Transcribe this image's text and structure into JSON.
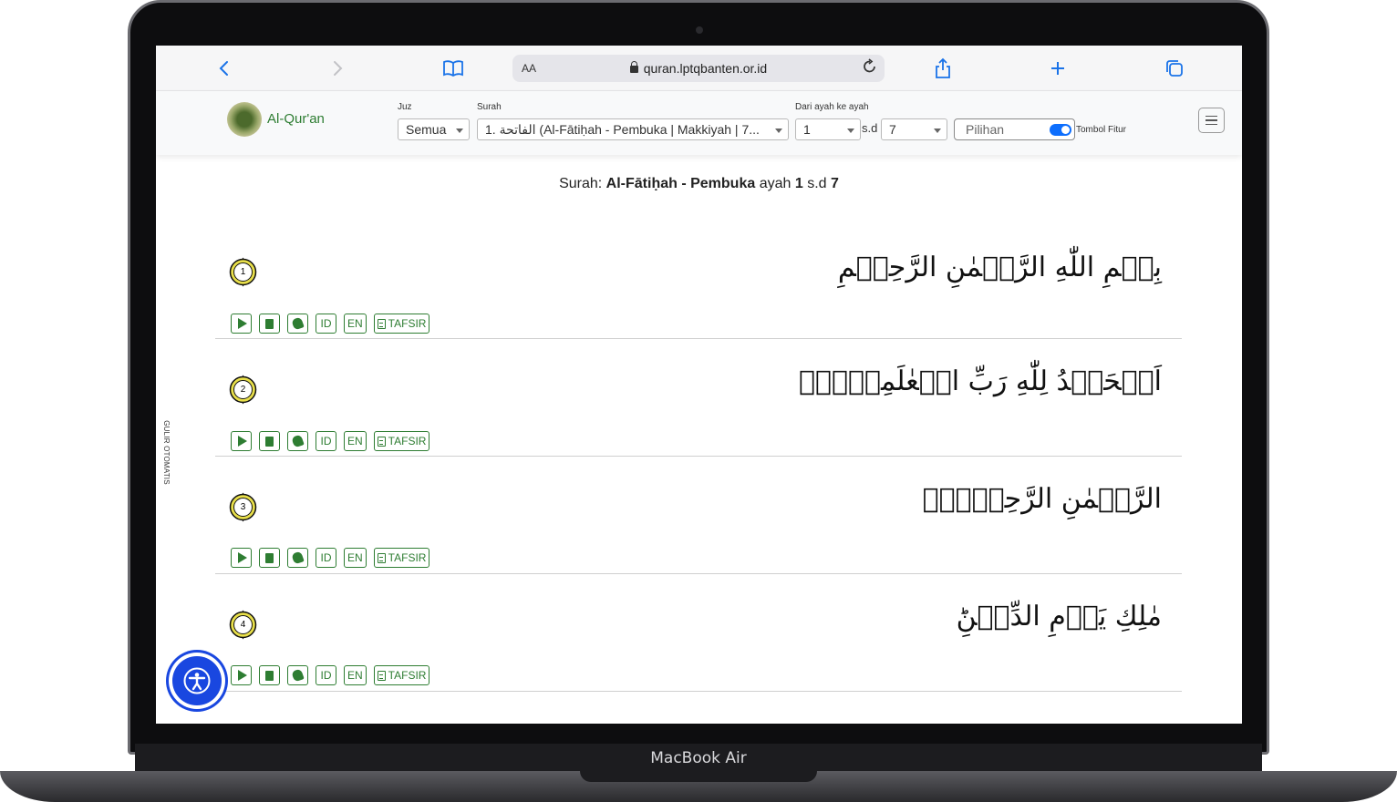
{
  "device": {
    "label": "MacBook Air"
  },
  "browser": {
    "url": "quran.lptqbanten.or.id",
    "reader_label": "AA"
  },
  "navbar": {
    "brand": "Al-Qur'an",
    "juz_label": "Juz",
    "juz_value": "Semua",
    "surah_label": "Surah",
    "surah_value": "1. الفاتحة (Al-Fātiḥah - Pembuka | Makkiyah | 7...",
    "range_label": "Dari ayah ke ayah",
    "range_from": "1",
    "range_sep": "s.d",
    "range_to": "7",
    "option_placeholder": "Pilihan",
    "feature_toggle_label": "Tombol Fitur"
  },
  "content": {
    "title_prefix": "Surah:",
    "title_name": "Al-Fātiḥah - Pembuka",
    "title_mid": "ayah",
    "title_from": "1",
    "title_sep": "s.d",
    "title_to": "7",
    "auto_scroll_label": "GULIR OTOMATIS"
  },
  "ayah_buttons": {
    "id": "ID",
    "en": "EN",
    "tafsir": "TAFSIR"
  },
  "ayahs": [
    {
      "number": "1",
      "text": "بِسۡمِ اللّٰهِ الرَّحۡمٰنِ الرَّحِيۡمِ"
    },
    {
      "number": "2",
      "text": "اَلۡحَمۡدُ لِلّٰهِ رَبِّ الۡعٰلَمِيۡنَۙ"
    },
    {
      "number": "3",
      "text": "الرَّحۡمٰنِ الرَّحِيۡمِۙ"
    },
    {
      "number": "4",
      "text": "مٰلِكِ يَوۡمِ الدِّيۡنِؕ"
    }
  ],
  "colors": {
    "accent": "#2e7d32",
    "toolbar_icon": "#1a73e8",
    "accessibility": "#1947e0"
  }
}
